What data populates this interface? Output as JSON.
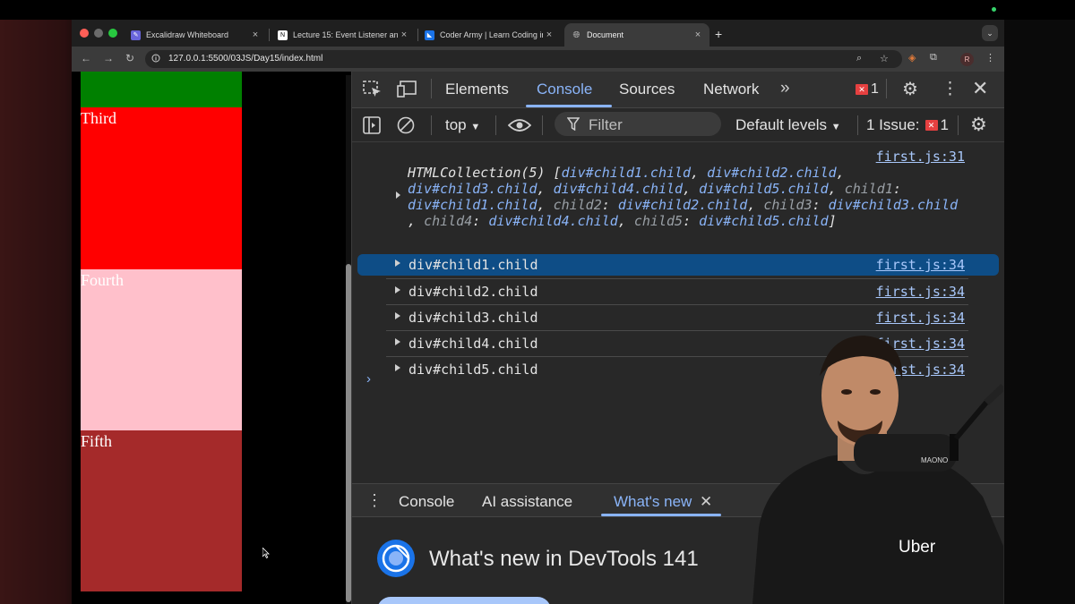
{
  "browser": {
    "tabs": [
      {
        "label": "Excalidraw Whiteboard",
        "favicon": "excalidraw-icon",
        "color": "#6965db",
        "active": false
      },
      {
        "label": "Lecture 15: Event Listener and",
        "favicon": "notion-icon",
        "color": "#ffffff",
        "active": false
      },
      {
        "label": "Coder Army | Learn Coding in",
        "favicon": "coder-army-icon",
        "color": "#1a73e8",
        "active": false
      },
      {
        "label": "Document",
        "favicon": "globe-icon",
        "color": "#9aa0a6",
        "active": true
      }
    ],
    "url": "127.0.0.1:5500/03JS/Day15/index.html",
    "profile_initial": "R"
  },
  "page": {
    "boxes": [
      {
        "label": "",
        "color": "#008000"
      },
      {
        "label": "Third",
        "color": "#ff0000"
      },
      {
        "label": "Fourth",
        "color": "#ffc0cb"
      },
      {
        "label": "Fifth",
        "color": "#a52a2a"
      }
    ]
  },
  "devtools": {
    "tabs": [
      "Elements",
      "Console",
      "Sources",
      "Network"
    ],
    "active_tab": "Console",
    "error_count": "1",
    "context": "top",
    "filter_placeholder": "Filter",
    "levels": "Default levels",
    "issues_label": "1 Issue:",
    "issues_count": "1",
    "console": {
      "collection_source": "first.js:31",
      "collection_prefix": "HTMLCollection(5) [",
      "collection_items": [
        "div#child1.child",
        "div#child2.child",
        "div#child3.child",
        "div#child4.child",
        "div#child5.child"
      ],
      "collection_props": [
        {
          "key": "child1",
          "value": "div#child1.child"
        },
        {
          "key": "child2",
          "value": "div#child2.child"
        },
        {
          "key": "child3",
          "value": "div#child3.child"
        },
        {
          "key": "child4",
          "value": "div#child4.child"
        },
        {
          "key": "child5",
          "value": "div#child5.child"
        }
      ],
      "rows": [
        {
          "text": "div#child1.child",
          "source": "first.js:34",
          "selected": true
        },
        {
          "text": "div#child2.child",
          "source": "first.js:34",
          "selected": false
        },
        {
          "text": "div#child3.child",
          "source": "first.js:34",
          "selected": false
        },
        {
          "text": "div#child4.child",
          "source": "first.js:34",
          "selected": false
        },
        {
          "text": "div#child5.child",
          "source": "first.js:34",
          "selected": false
        }
      ]
    },
    "drawer": {
      "tabs": [
        "Console",
        "AI assistance",
        "What's new"
      ],
      "active_tab": "What's new",
      "whats_new_title": "What's new in DevTools 141"
    }
  },
  "presenter": {
    "shirt_text": "Uber",
    "mic_brand": "MAONO"
  }
}
